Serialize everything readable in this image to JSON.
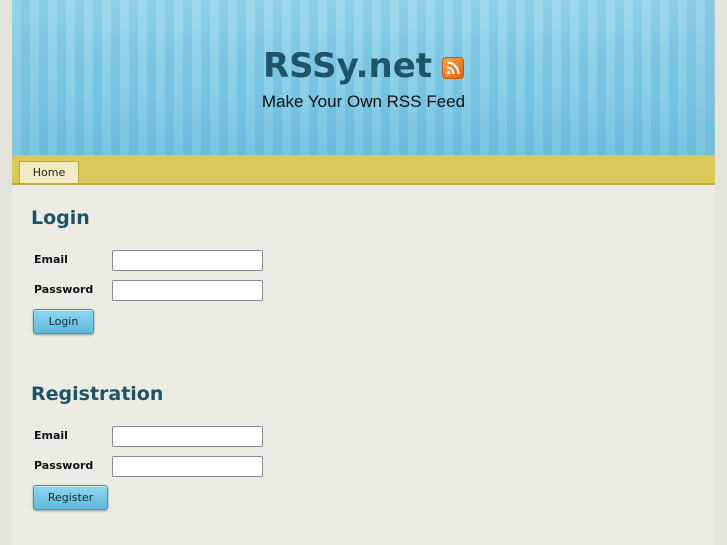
{
  "header": {
    "site_title": "RSSy.net",
    "tagline": "Make Your Own RSS Feed",
    "icon": "rss-feed-icon"
  },
  "nav": {
    "items": [
      {
        "label": "Home"
      }
    ]
  },
  "login": {
    "title": "Login",
    "email_label": "Email",
    "email_value": "",
    "password_label": "Password",
    "password_value": "",
    "button_label": "Login"
  },
  "registration": {
    "title": "Registration",
    "email_label": "Email",
    "email_value": "",
    "password_label": "Password",
    "password_value": "",
    "button_label": "Register"
  },
  "colors": {
    "title": "#1f5368",
    "navbar": "#dac85a",
    "button": "#5fb9dd",
    "rss_icon": "#e2650f"
  }
}
